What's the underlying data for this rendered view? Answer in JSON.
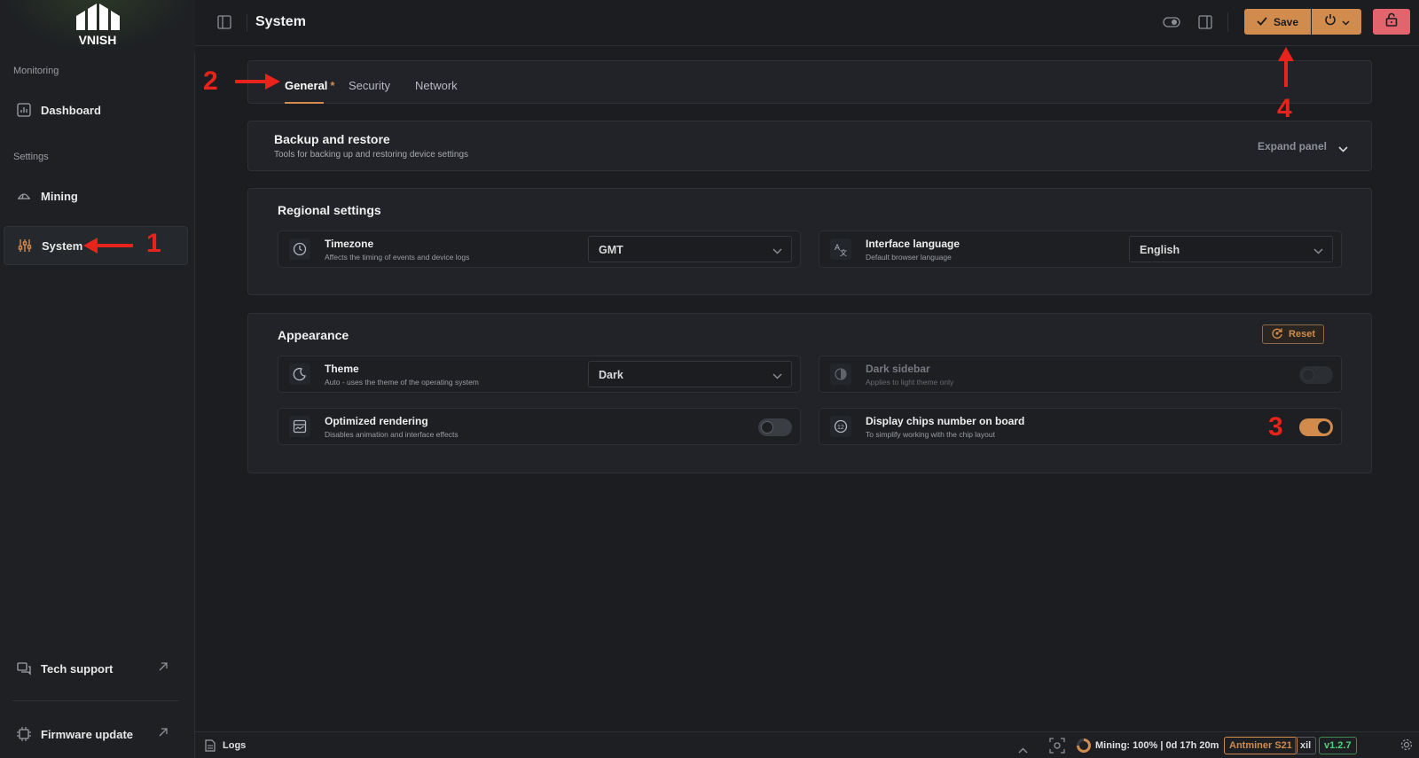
{
  "sidebar": {
    "logo_text": "VNISH",
    "sections": {
      "monitoring": "Monitoring",
      "settings": "Settings"
    },
    "items": {
      "dashboard": "Dashboard",
      "mining": "Mining",
      "system": "System",
      "tech_support": "Tech support",
      "firmware_update": "Firmware update"
    }
  },
  "header": {
    "title": "System",
    "save_label": "Save"
  },
  "tabs": [
    {
      "label": "General",
      "modified": "*"
    },
    {
      "label": "Security"
    },
    {
      "label": "Network"
    }
  ],
  "backup": {
    "title": "Backup and restore",
    "subtitle": "Tools for backing up and restoring device settings",
    "expand_label": "Expand panel"
  },
  "regional": {
    "title": "Regional settings",
    "timezone": {
      "name": "Timezone",
      "desc": "Affects the timing of events and device logs",
      "value": "GMT"
    },
    "language": {
      "name": "Interface language",
      "desc": "Default browser language",
      "value": "English"
    }
  },
  "appearance": {
    "title": "Appearance",
    "reset_label": "Reset",
    "theme": {
      "name": "Theme",
      "desc": "Auto - uses the theme of the operating system",
      "value": "Dark"
    },
    "dark_sidebar": {
      "name": "Dark sidebar",
      "desc": "Applies to light theme only",
      "enabled": false,
      "disabled": true
    },
    "optimized_rendering": {
      "name": "Optimized rendering",
      "desc": "Disables animation and interface effects",
      "enabled": false
    },
    "chips_number": {
      "name": "Display chips number on board",
      "desc": "To simplify working with the chip layout",
      "enabled": true
    }
  },
  "annotations": [
    "1",
    "2",
    "3",
    "4"
  ],
  "statusbar": {
    "logs_label": "Logs",
    "mining_status": "Mining: 100% | 0d 17h 20m",
    "model": "Antminer S21",
    "variant": "xil",
    "version": "v1.2.7"
  },
  "colors": {
    "accent": "#d18b4d",
    "danger": "#e2646c",
    "annotation": "#e8231c",
    "version_green": "#4fd37a"
  }
}
